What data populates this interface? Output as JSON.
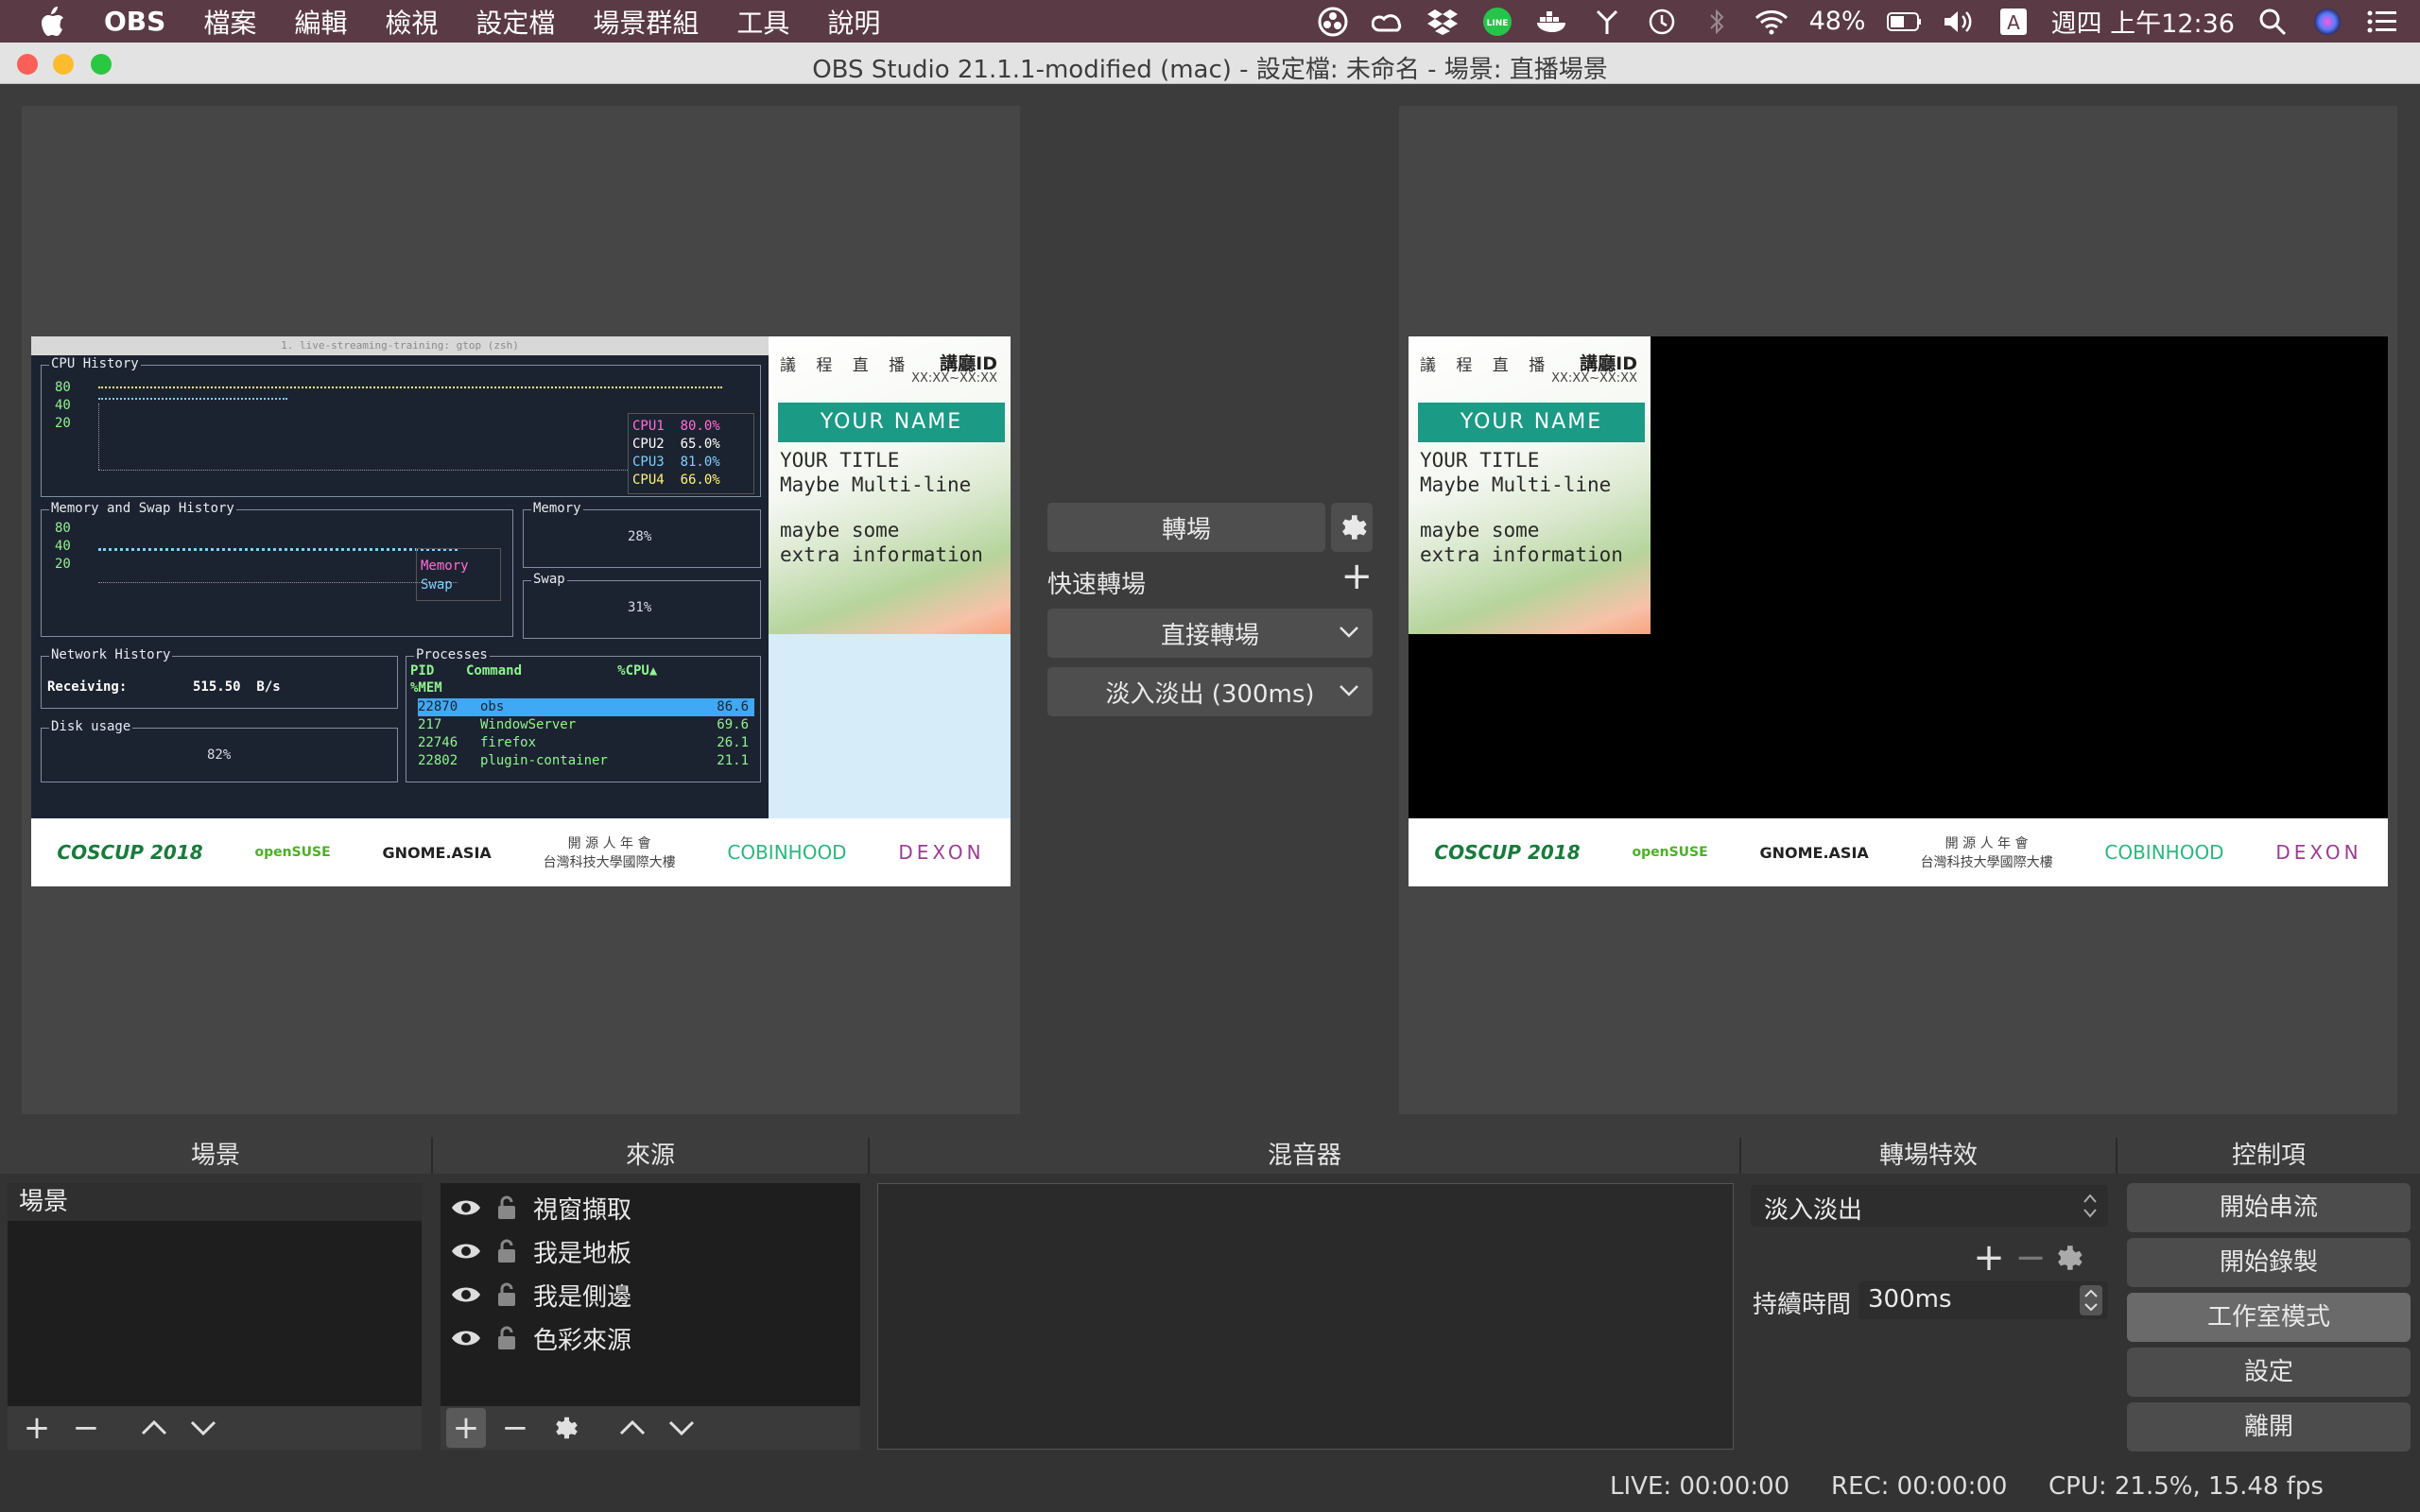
{
  "menubar": {
    "app": "OBS",
    "items": [
      "檔案",
      "編輯",
      "檢視",
      "設定檔",
      "場景群組",
      "工具",
      "說明"
    ],
    "battery": "48%",
    "clock": "週四 上午12:36"
  },
  "window": {
    "title": "OBS Studio 21.1.1-modified (mac) - 設定檔: 未命名 - 場景: 直播場景"
  },
  "preview": {
    "gtop": {
      "window_title": "1. live-streaming-training: gtop (zsh)",
      "cpu_history": "CPU History",
      "cpu_scale": "80\n40\n20",
      "cpu_legend": [
        {
          "label": "CPU1",
          "value": "80.0%",
          "color": "#ff6fd8"
        },
        {
          "label": "CPU2",
          "value": "65.0%",
          "color": "#ffffff"
        },
        {
          "label": "CPU3",
          "value": "81.0%",
          "color": "#7fd0ff"
        },
        {
          "label": "CPU4",
          "value": "66.0%",
          "color": "#fff480"
        }
      ],
      "mem_swap_history": "Memory and Swap History",
      "mem_scale": "80\n40\n20",
      "mem_legend_memory": "Memory",
      "mem_legend_swap": "Swap",
      "memory_title": "Memory",
      "memory_value": "28%",
      "swap_title": "Swap",
      "swap_value": "31%",
      "network_history": "Network History",
      "receiving_label": "Receiving:",
      "receiving_value": "515.50  B/s",
      "disk_usage": "Disk usage",
      "disk_value": "82%",
      "processes": "Processes",
      "proc_header": "PID    Command            %CPU▲",
      "proc_header2": "%MEM",
      "proc_rows": [
        {
          "pid": "22870",
          "cmd": "obs",
          "cpu": "86.6"
        },
        {
          "pid": "217",
          "cmd": "WindowServer",
          "cpu": "69.6"
        },
        {
          "pid": "22746",
          "cmd": "firefox",
          "cpu": "26.1"
        },
        {
          "pid": "22802",
          "cmd": "plugin-container",
          "cpu": "21.1"
        }
      ]
    },
    "card": {
      "label": "議 程 直 播",
      "session_id": "講廳ID",
      "session_no": "XX:XX~XX:XX",
      "name": "YOUR NAME",
      "title_lines": "YOUR TITLE\nMaybe Multi-line",
      "extra_lines": "maybe some\nextra information"
    },
    "logos": [
      "COSCUP 2018",
      "openSUSE",
      "GNOME.ASIA",
      "開 源 人 年 會",
      "台灣科技大學國際大樓",
      "COBINHOOD",
      "DEXON"
    ]
  },
  "transition_panel": {
    "transition_button": "轉場",
    "quick_transitions": "快速轉場",
    "options": [
      "直接轉場",
      "淡入淡出 (300ms)"
    ]
  },
  "docks": {
    "scenes_title": "場景",
    "scenes": [
      "場景"
    ],
    "sources_title": "來源",
    "sources": [
      "視窗擷取",
      "我是地板",
      "我是側邊",
      "色彩來源"
    ],
    "mixer_title": "混音器",
    "transitions_title": "轉場特效",
    "transition_select": "淡入淡出",
    "duration_label": "持續時間",
    "duration_value": "300ms",
    "controls_title": "控制項",
    "controls": [
      "開始串流",
      "開始錄製",
      "工作室模式",
      "設定",
      "離開"
    ]
  },
  "status": {
    "live": "LIVE: 00:00:00",
    "rec": "REC: 00:00:00",
    "cpu": "CPU: 21.5%, 15.48 fps"
  },
  "colors": {
    "accent_teal": "#1b9a86",
    "menubar": "#5a3a44",
    "close": "#fc5f57",
    "minimize": "#fdbc2e",
    "maximize": "#28c840"
  }
}
